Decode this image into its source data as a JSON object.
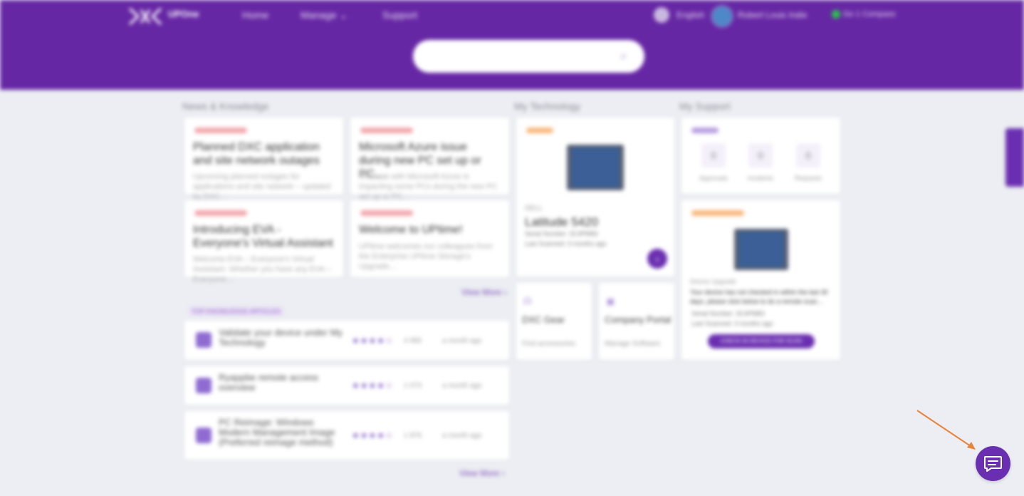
{
  "header": {
    "logo_text": "UPOne",
    "nav": {
      "home": "Home",
      "manage": "Manage",
      "support": "Support"
    },
    "language": "English",
    "user_name": "Robert Louis Indie",
    "status": "Go 1 Compass",
    "search_placeholder": ""
  },
  "sections": {
    "news": "News & Knowledge",
    "tech": "My Technology",
    "support": "My Support"
  },
  "news": [
    {
      "title": "Planned DXC application and site network outages",
      "desc": "Upcoming planned outages for applications and site network – updated by DXC…"
    },
    {
      "title": "Microsoft Azure issue during new PC set up or PC…",
      "desc": "An issue with Microsoft Azure is impacting some PCs during the new PC set up or PC…"
    },
    {
      "title": "Introducing EVA - Everyone's Virtual Assistant",
      "desc": "Welcome EVA – Everyone's Virtual Assistant. Whether you have any EVA – Everyone…"
    },
    {
      "title": "Welcome to UPtime!",
      "desc": "UPtime welcomes our colleagues from the Enterprise UPtime Storage's Upgrade…"
    }
  ],
  "view_more": "View More",
  "kb": {
    "label": "TOP KNOWLEDGE ARTICLES",
    "items": [
      {
        "title": "Validate your device under My Technology",
        "rating": "★★★★☆",
        "views": "4 995",
        "date": "a month ago"
      },
      {
        "title": "Ryappbe remote access overview",
        "rating": "★★★★☆",
        "views": "1 073",
        "date": "a month ago"
      },
      {
        "title": "PC Reimage: Windows Modern Management Image (Preferred reimage method)",
        "rating": "★★★★☆",
        "views": "1 876",
        "date": "a month ago"
      }
    ]
  },
  "tech": {
    "device_brand": "DELL",
    "device_name": "Latitude 5420",
    "serial": "Serial Number: 3C4PM83",
    "last_scanned": "Last Scanned: 3 months ago",
    "go_label": "›",
    "tiles": [
      {
        "icon": "headset-icon",
        "title": "DXC Gear",
        "desc": "Find accessories"
      },
      {
        "icon": "portal-icon",
        "title": "Company Portal",
        "desc": "Manage Software"
      }
    ]
  },
  "support": {
    "counts": [
      {
        "value": "0",
        "label": "Approvals"
      },
      {
        "value": "0",
        "label": "Incidents"
      },
      {
        "value": "0",
        "label": "Requests"
      }
    ],
    "device_label": "Device Upgrade",
    "message": "Your device has not checked in within the last 30 days, please click below to do a remote scan…",
    "serial": "Serial Number: 3C4PM83",
    "last_scanned": "Last Scanned: 3 months ago",
    "button": "CHECK-IN DEVICE FOR SCAN"
  },
  "chat": {
    "icon": "chat-icon"
  },
  "colors": {
    "brand": "#6627a4",
    "accent": "#6a2fb0",
    "arrow": "#e8833a"
  }
}
